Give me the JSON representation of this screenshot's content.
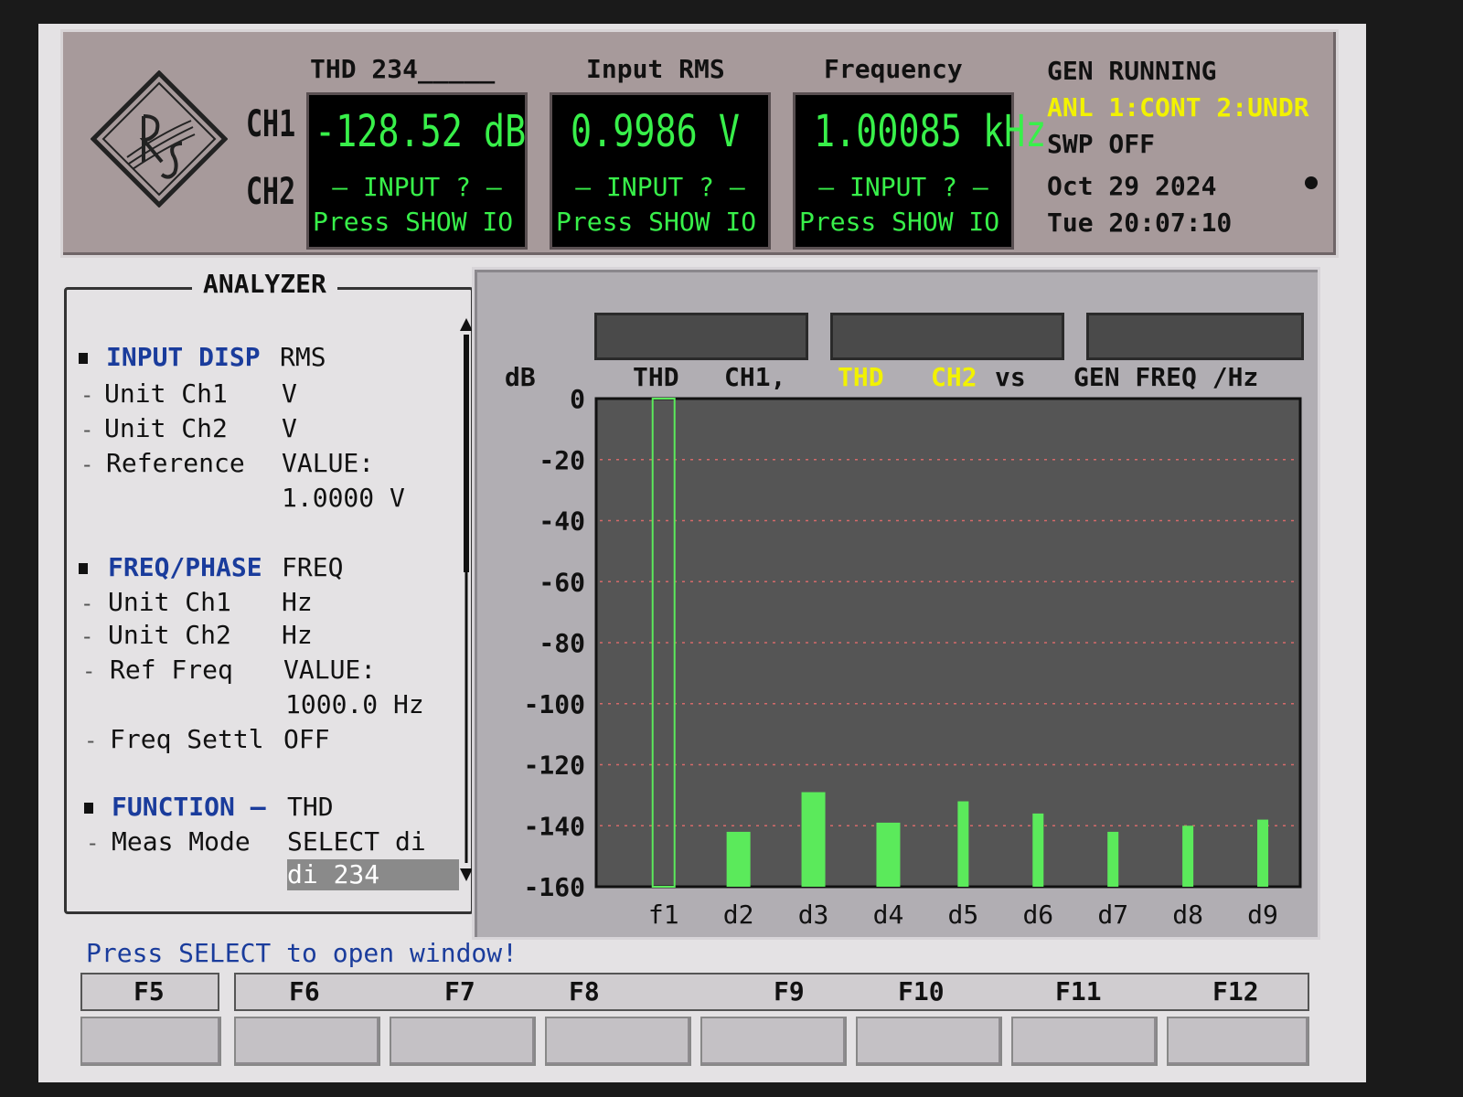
{
  "header": {
    "ch1_label": "CH1",
    "ch2_label": "CH2",
    "meters": [
      {
        "title": "THD 234_____",
        "value": "-128.52 dB",
        "line2": "– INPUT ? –",
        "line3": "Press SHOW IO"
      },
      {
        "title": "Input RMS",
        "value": "0.9986  V",
        "line2": "– INPUT ? –",
        "line3": "Press SHOW IO"
      },
      {
        "title": "Frequency",
        "value": "1.00085 kHz",
        "line2": "– INPUT ? –",
        "line3": "Press SHOW IO"
      }
    ],
    "status": {
      "gen": "GEN RUNNING",
      "anl": "ANL 1:CONT 2:UNDR",
      "swp": "SWP OFF",
      "date": "Oct 29 2024",
      "time": "Tue 20:07:10"
    }
  },
  "analyzer": {
    "title": "ANALYZER",
    "sections": [
      {
        "label": "INPUT DISP",
        "value": "RMS"
      },
      {
        "label": "FREQ/PHASE",
        "value": "FREQ"
      },
      {
        "label": "FUNCTION –",
        "value": "THD"
      }
    ],
    "rows": [
      {
        "label": "Unit Ch1",
        "value": "V"
      },
      {
        "label": "Unit Ch2",
        "value": "V"
      },
      {
        "label": "Reference",
        "value": "VALUE:"
      },
      {
        "label": "",
        "value": "1.0000 V"
      },
      {
        "label": "Unit Ch1",
        "value": "Hz"
      },
      {
        "label": "Unit Ch2",
        "value": "Hz"
      },
      {
        "label": "Ref Freq",
        "value": "VALUE:"
      },
      {
        "label": "",
        "value": "1000.0 Hz"
      },
      {
        "label": "Freq Settl",
        "value": "OFF"
      },
      {
        "label": "Meas Mode",
        "value": "SELECT di"
      },
      {
        "label": "",
        "value": "di 234"
      }
    ]
  },
  "chart_caption": {
    "unit": "dB",
    "thd1": "THD",
    "ch1": "CH1,",
    "thd2": "THD",
    "ch2": "CH2",
    "vs": "vs",
    "gen": "GEN FREQ /Hz"
  },
  "chart_data": {
    "type": "bar",
    "categories": [
      "f1",
      "d2",
      "d3",
      "d4",
      "d5",
      "d6",
      "d7",
      "d8",
      "d9"
    ],
    "values": [
      0,
      -142,
      -129,
      -139,
      -132,
      -136,
      -142,
      -140,
      -138
    ],
    "ylabel": "dB",
    "ylim": [
      -160,
      0
    ],
    "yticks": [
      0,
      -20,
      -40,
      -60,
      -80,
      -100,
      -120,
      -140,
      -160
    ],
    "colors": {
      "bar": "#5bea5b",
      "grid": "#d66a6a",
      "plot_bg": "#555555"
    },
    "grid": true
  },
  "message": "Press SELECT to open window!",
  "softkeys": [
    "F5",
    "F6",
    "F7",
    "F8",
    "F9",
    "F10",
    "F11",
    "F12"
  ]
}
